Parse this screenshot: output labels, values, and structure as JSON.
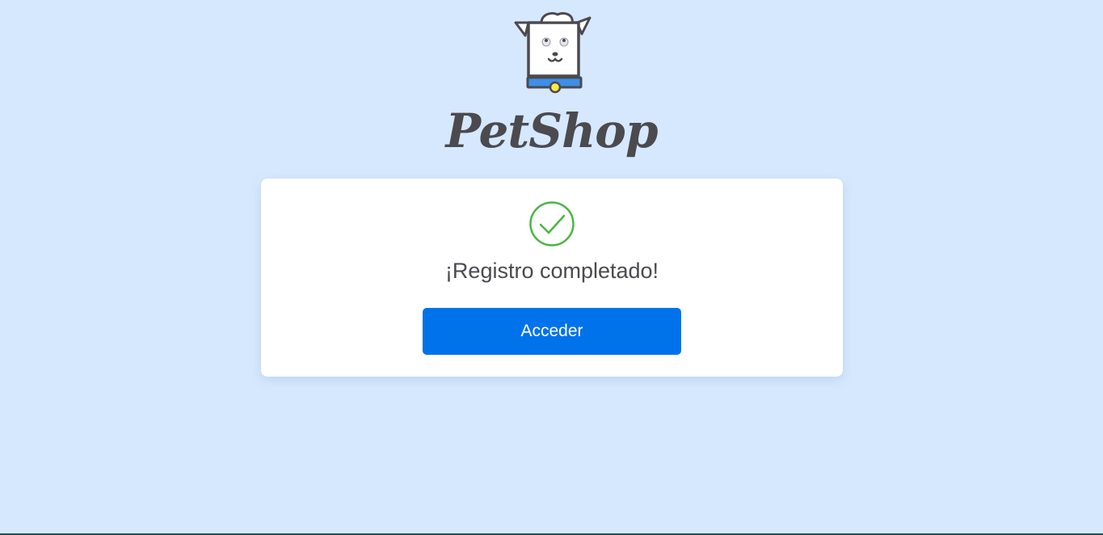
{
  "brand": {
    "name": "PetShop",
    "logo_icon": "dog-mascot-icon"
  },
  "card": {
    "status_icon": "check-circle-icon",
    "message": "¡Registro completado!",
    "button_label": "Acceder"
  },
  "colors": {
    "background": "#d6e8fd",
    "card": "#ffffff",
    "primary_button": "#0073ea",
    "success": "#4bb543",
    "text": "#4a4a4f",
    "collar": "#3d8fe8",
    "collar_tag": "#ffe84a"
  }
}
